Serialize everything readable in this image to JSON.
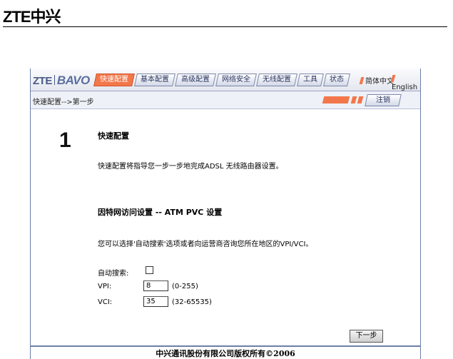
{
  "doc": {
    "logo": "ZTE中兴"
  },
  "header": {
    "brand_left": "ZTE",
    "brand_right": "BAVO",
    "tabs": [
      "快速配置",
      "基本配置",
      "高级配置",
      "网络安全",
      "无线配置",
      "工具",
      "状态"
    ],
    "active_tab": "快速配置",
    "lang_cn": "简体中文",
    "lang_en": "English"
  },
  "breadcrumb": {
    "text": "快速配置-->第一步",
    "logout": "注销"
  },
  "main": {
    "step_number": "1",
    "title": "快速配置",
    "description": "快速配置将指导您一步一步地完成ADSL 无线路由器设置。",
    "section_title": "因特网访问设置 -- ATM PVC 设置",
    "section_description": "您可以选择'自动搜索'选项或者向运营商咨询您所在地区的VPI/VCI。",
    "auto_search_label": "自动搜索:",
    "auto_search_checked": false,
    "vpi_label": "VPI:",
    "vpi_value": "8",
    "vpi_hint": "(0-255)",
    "vci_label": "VCI:",
    "vci_value": "35",
    "vci_hint": "(32-65535)",
    "next_button": "下一步"
  },
  "footer": {
    "copyright": "中兴通讯股份有限公司版权所有©2006"
  },
  "colors": {
    "accent": "#f2774a",
    "frame": "#6d7ea8"
  }
}
